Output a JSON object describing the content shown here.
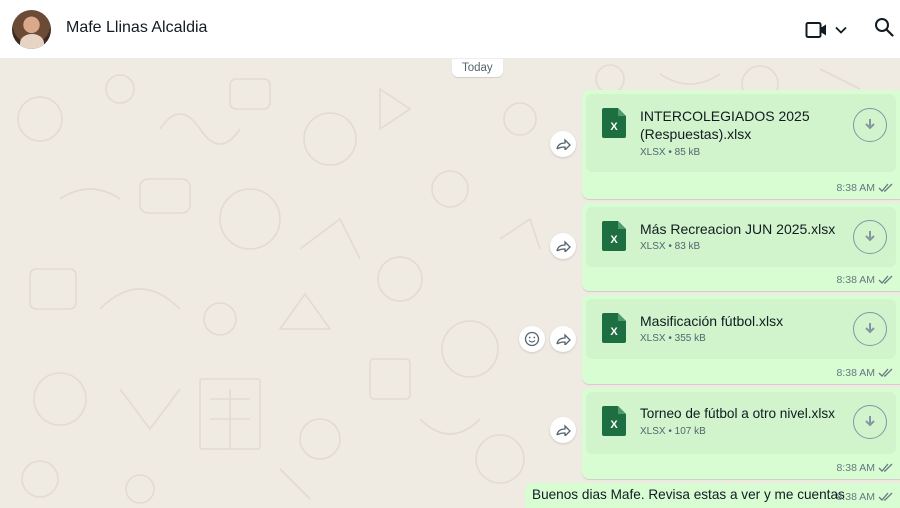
{
  "header": {
    "contact_name": "Mafe Llinas Alcaldia",
    "video_icon": "video-camera-icon",
    "dropdown_icon": "chevron-down-icon",
    "search_icon": "search-icon"
  },
  "chat": {
    "date_label": "Today",
    "file_messages": [
      {
        "name_line1": "INTERCOLEGIADOS 2025",
        "name_line2": "(Respuestas).xlsx",
        "meta": "XLSX • 85 kB",
        "time": "8:38 AM"
      },
      {
        "name_line1": "Más Recreacion JUN 2025.xlsx",
        "name_line2": "",
        "meta": "XLSX • 83 kB",
        "time": "8:38 AM"
      },
      {
        "name_line1": "Masificación fútbol.xlsx",
        "name_line2": "",
        "meta": "XLSX • 355 kB",
        "time": "8:38 AM"
      },
      {
        "name_line1": "Torneo de fútbol a otro nivel.xlsx",
        "name_line2": "",
        "meta": "XLSX • 107 kB",
        "time": "8:38 AM"
      }
    ],
    "text_message": {
      "text": "Buenos dias Mafe. Revisa estas a ver y me cuentas",
      "time": "8:38 AM"
    },
    "file_icon_letter": "X"
  },
  "colors": {
    "outgoing_bubble": "#d9fdd3",
    "file_card": "#d1f4cc",
    "excel_green": "#1d6f42",
    "read_ticks": "#667781",
    "chat_background": "#efeae2"
  }
}
